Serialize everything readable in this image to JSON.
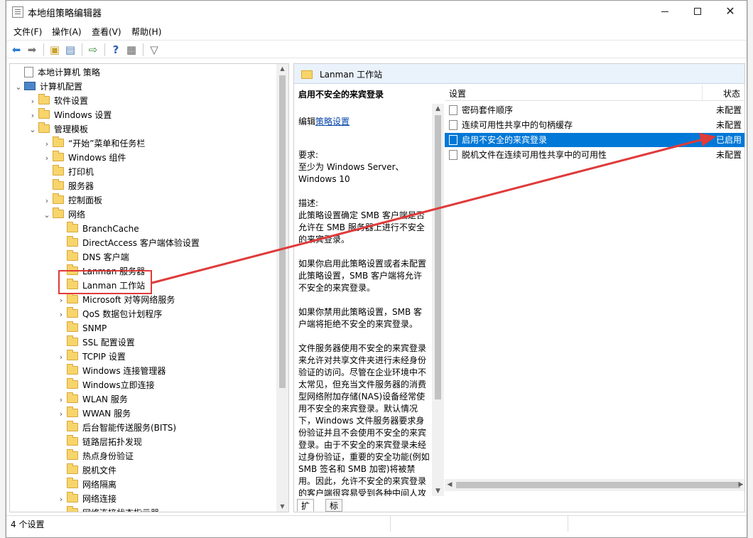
{
  "window": {
    "title": "本地组策略编辑器"
  },
  "menu": [
    "文件(F)",
    "操作(A)",
    "查看(V)",
    "帮助(H)"
  ],
  "tree": [
    {
      "label": "本地计算机 策略",
      "depth": 0,
      "chevron": "",
      "icon": "doc"
    },
    {
      "label": "计算机配置",
      "depth": 0,
      "chevron": "expanded",
      "icon": "pc"
    },
    {
      "label": "软件设置",
      "depth": 1,
      "chevron": "collapsed",
      "icon": "folder"
    },
    {
      "label": "Windows 设置",
      "depth": 1,
      "chevron": "collapsed",
      "icon": "folder"
    },
    {
      "label": "管理模板",
      "depth": 1,
      "chevron": "expanded",
      "icon": "folder"
    },
    {
      "label": "“开始”菜单和任务栏",
      "depth": 2,
      "chevron": "collapsed",
      "icon": "folder"
    },
    {
      "label": "Windows 组件",
      "depth": 2,
      "chevron": "collapsed",
      "icon": "folder"
    },
    {
      "label": "打印机",
      "depth": 2,
      "chevron": "",
      "icon": "folder"
    },
    {
      "label": "服务器",
      "depth": 2,
      "chevron": "",
      "icon": "folder"
    },
    {
      "label": "控制面板",
      "depth": 2,
      "chevron": "collapsed",
      "icon": "folder"
    },
    {
      "label": "网络",
      "depth": 2,
      "chevron": "expanded",
      "icon": "folder"
    },
    {
      "label": "BranchCache",
      "depth": 3,
      "chevron": "",
      "icon": "folder"
    },
    {
      "label": "DirectAccess 客户端体验设置",
      "depth": 3,
      "chevron": "",
      "icon": "folder"
    },
    {
      "label": "DNS 客户端",
      "depth": 3,
      "chevron": "",
      "icon": "folder"
    },
    {
      "label": "Lanman 服务器",
      "depth": 3,
      "chevron": "",
      "icon": "folder"
    },
    {
      "label": "Lanman 工作站",
      "depth": 3,
      "chevron": "",
      "icon": "folder",
      "highlighted": true
    },
    {
      "label": "Microsoft 对等网络服务",
      "depth": 3,
      "chevron": "collapsed",
      "icon": "folder"
    },
    {
      "label": "QoS 数据包计划程序",
      "depth": 3,
      "chevron": "collapsed",
      "icon": "folder"
    },
    {
      "label": "SNMP",
      "depth": 3,
      "chevron": "",
      "icon": "folder"
    },
    {
      "label": "SSL 配置设置",
      "depth": 3,
      "chevron": "",
      "icon": "folder"
    },
    {
      "label": "TCPIP 设置",
      "depth": 3,
      "chevron": "collapsed",
      "icon": "folder"
    },
    {
      "label": "Windows 连接管理器",
      "depth": 3,
      "chevron": "",
      "icon": "folder"
    },
    {
      "label": "Windows立即连接",
      "depth": 3,
      "chevron": "",
      "icon": "folder"
    },
    {
      "label": "WLAN 服务",
      "depth": 3,
      "chevron": "collapsed",
      "icon": "folder"
    },
    {
      "label": "WWAN 服务",
      "depth": 3,
      "chevron": "collapsed",
      "icon": "folder"
    },
    {
      "label": "后台智能传送服务(BITS)",
      "depth": 3,
      "chevron": "",
      "icon": "folder"
    },
    {
      "label": "链路层拓扑发现",
      "depth": 3,
      "chevron": "",
      "icon": "folder"
    },
    {
      "label": "热点身份验证",
      "depth": 3,
      "chevron": "",
      "icon": "folder"
    },
    {
      "label": "脱机文件",
      "depth": 3,
      "chevron": "",
      "icon": "folder"
    },
    {
      "label": "网络隔离",
      "depth": 3,
      "chevron": "",
      "icon": "folder"
    },
    {
      "label": "网络连接",
      "depth": 3,
      "chevron": "collapsed",
      "icon": "folder"
    },
    {
      "label": "网络连接状态指示器",
      "depth": 3,
      "chevron": "",
      "icon": "folder"
    }
  ],
  "right": {
    "header": "Lanman 工作站",
    "desc_title": "启用不安全的来宾登录",
    "edit_prefix": "编辑",
    "edit_link": "策略设置",
    "desc_paragraphs": [
      "要求:\n至少为 Windows Server、Windows 10",
      "描述:\n此策略设置确定 SMB 客户端是否允许在 SMB 服务器上进行不安全的来宾登录。",
      "如果你启用此策略设置或者未配置此策略设置，SMB 客户端将允许不安全的来宾登录。",
      "如果你禁用此策略设置，SMB 客户端将拒绝不安全的来宾登录。",
      "文件服务器使用不安全的来宾登录来允许对共享文件夹进行未经身份验证的访问。尽管在企业环境中不太常见，但充当文件服务器的消费型网络附加存储(NAS)设备经常使用不安全的来宾登录。默认情况下，Windows 文件服务器要求身份验证并且不会使用不安全的来宾登录。由于不安全的来宾登录未经过身份验证，重要的安全功能(例如 SMB 签名和 SMB 加密)将被禁用。因此，允许不安全的来宾登录的客户端很容易受到各种中间人攻击，从而导致数据丢失、数据损坏"
    ],
    "columns": {
      "setting": "设置",
      "state": "状态"
    },
    "rows": [
      {
        "name": "密码套件顺序",
        "state": "未配置",
        "selected": false
      },
      {
        "name": "连续可用性共享中的句柄缓存",
        "state": "未配置",
        "selected": false
      },
      {
        "name": "启用不安全的来宾登录",
        "state": "已启用",
        "selected": true
      },
      {
        "name": "脱机文件在连续可用性共享中的可用性",
        "state": "未配置",
        "selected": false
      }
    ],
    "tabs": [
      "扩展",
      "标准"
    ]
  },
  "status": {
    "text": "4 个设置"
  },
  "colors": {
    "selection": "#0078d7",
    "annotation": "#e03a3a"
  }
}
